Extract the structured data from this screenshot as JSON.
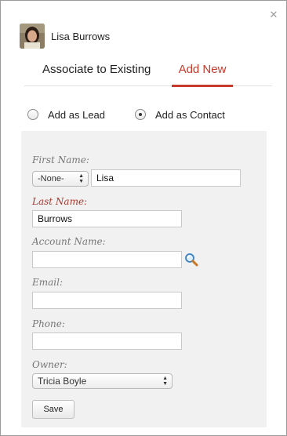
{
  "header": {
    "contact_name": "Lisa Burrows"
  },
  "tabs": [
    {
      "label": "Associate to Existing",
      "active": false
    },
    {
      "label": "Add New",
      "active": true
    }
  ],
  "radios": {
    "lead_label": "Add as Lead",
    "contact_label": "Add as Contact",
    "selected": "contact"
  },
  "form": {
    "first_name": {
      "label": "First Name:",
      "salutation": "-None-",
      "value": "Lisa"
    },
    "last_name": {
      "label": "Last Name:",
      "value": "Burrows"
    },
    "account_name": {
      "label": "Account Name:",
      "value": ""
    },
    "email": {
      "label": "Email:",
      "value": ""
    },
    "phone": {
      "label": "Phone:",
      "value": ""
    },
    "owner": {
      "label": "Owner:",
      "value": "Tricia Boyle"
    },
    "save_label": "Save"
  },
  "icons": {
    "close": "close-icon",
    "lookup": "magnifier-icon",
    "select_arrows": "updown-arrows-icon"
  },
  "colors": {
    "accent": "#c7392b",
    "required_label": "#a33a30"
  }
}
